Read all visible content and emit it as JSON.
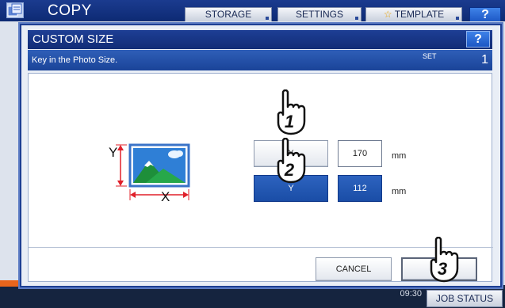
{
  "background": {
    "title": "COPY",
    "tabs": [
      "STORAGE",
      "SETTINGS",
      "TEMPLATE"
    ],
    "help": "?",
    "time": "09:30",
    "job_status": "JOB STATUS"
  },
  "dialog": {
    "title": "CUSTOM SIZE",
    "help": "?",
    "message": "Key in the Photo Size.",
    "set_label": "SET",
    "set_value": "1",
    "axis_x": "X",
    "axis_y": "Y",
    "x_button": "X",
    "y_button": "Y",
    "x_value": "170",
    "y_value": "112",
    "unit": "mm",
    "cancel": "CANCEL",
    "ok": "OK"
  },
  "steps": [
    "1",
    "2",
    "3"
  ],
  "colors": {
    "titlebar": "#112c76",
    "accent": "#1a4da6",
    "bottom_bar": "#15243f"
  }
}
